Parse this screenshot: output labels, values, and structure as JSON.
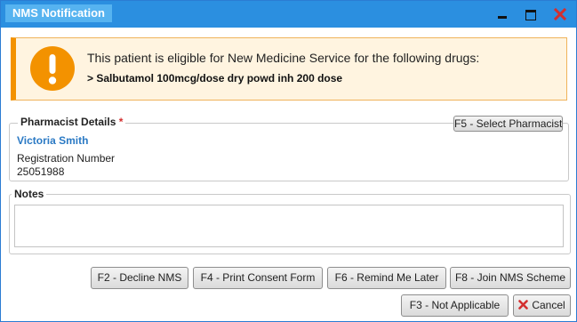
{
  "window": {
    "title": "NMS Notification"
  },
  "alert": {
    "message": "This patient is eligible for New Medicine Service for the following drugs:",
    "drug": "> Salbutamol 100mcg/dose dry powd inh 200 dose",
    "icon": "exclamation-icon",
    "accent_color": "#f39200"
  },
  "pharmacist": {
    "section_label": "Pharmacist Details",
    "required_marker": "*",
    "select_button": "F5 - Select Pharmacist",
    "name": "Victoria Smith",
    "registration_label": "Registration Number",
    "registration_number": "25051988"
  },
  "notes": {
    "section_label": "Notes",
    "value": ""
  },
  "actions": {
    "decline": "F2 - Decline NMS",
    "print_consent": "F4 - Print Consent Form",
    "remind_later": "F6 - Remind Me Later",
    "join_scheme": "F8 - Join NMS Scheme",
    "not_applicable": "F3 - Not Applicable",
    "cancel": "Cancel"
  },
  "colors": {
    "titlebar": "#2b8fe0",
    "pharmacist_name": "#2a79c4",
    "close_icon": "#d32f2f"
  }
}
